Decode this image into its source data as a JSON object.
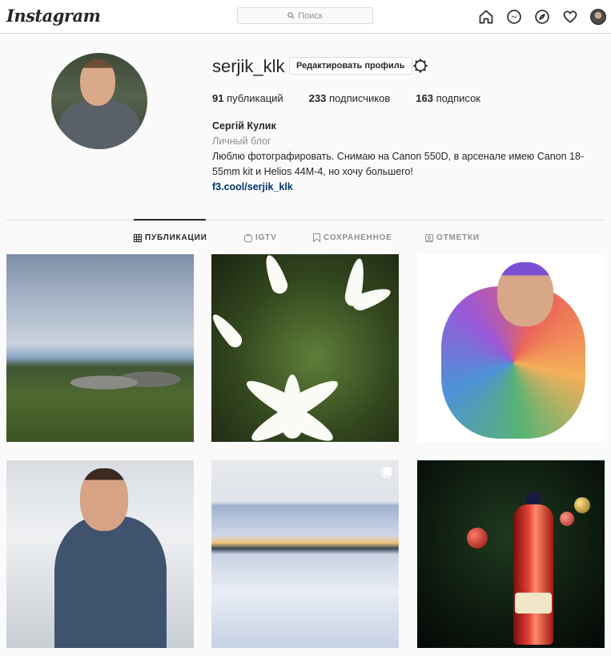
{
  "app": {
    "logo_text": "Instagram",
    "search_placeholder": "Поиск"
  },
  "nav_icons": [
    "home-icon",
    "messenger-icon",
    "explore-icon",
    "heart-icon",
    "profile-avatar"
  ],
  "profile": {
    "username": "serjik_klk",
    "edit_button": "Редактировать профиль",
    "stats": {
      "posts_count": "91",
      "posts_label": "публикаций",
      "followers_count": "233",
      "followers_label": "подписчиков",
      "following_count": "163",
      "following_label": "подписок"
    },
    "full_name": "Сергій Кулик",
    "category": "Личный блог",
    "bio": "Люблю фотографировать. Снимаю на Canon 550D, в арсенале имею Canon 18-55mm kit и Helios 44M-4, но хочу большего!",
    "website": "f3.cool/serjik_klk"
  },
  "tabs": [
    {
      "label": "ПУБЛИКАЦИИ",
      "icon": "grid-icon",
      "active": true
    },
    {
      "label": "IGTV",
      "icon": "igtv-icon",
      "active": false
    },
    {
      "label": "СОХРАНЕННОЕ",
      "icon": "bookmark-icon",
      "active": false
    },
    {
      "label": "ОТМЕТКИ",
      "icon": "tagged-icon",
      "active": false
    }
  ],
  "posts": [
    {
      "subject": "sky-and-rocks-landscape"
    },
    {
      "subject": "white-flowers"
    },
    {
      "subject": "color-splash-portrait"
    },
    {
      "subject": "winter-portrait"
    },
    {
      "subject": "snowy-field-sunset",
      "multiple": true
    },
    {
      "subject": "champagne-christmas-tree"
    }
  ],
  "colors": {
    "background": "#fafafa",
    "border": "#dbdbdb",
    "text": "#262626",
    "muted": "#8e8e8e",
    "link": "#00376b"
  }
}
